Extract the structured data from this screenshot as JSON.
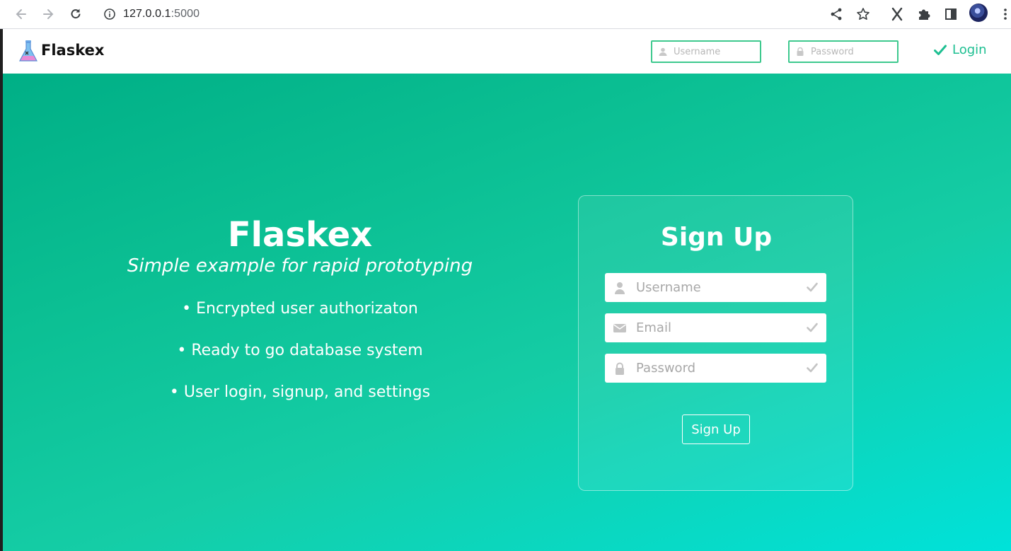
{
  "browser": {
    "url_host": "127.0.0.1",
    "url_port": ":5000"
  },
  "navbar": {
    "brand": "Flaskex",
    "username_placeholder": "Username",
    "password_placeholder": "Password",
    "login_label": "Login"
  },
  "hero": {
    "title": "Flaskex",
    "subtitle": "Simple example for rapid prototyping",
    "features": [
      "• Encrypted user authorizaton",
      "• Ready to go database system",
      "• User login, signup, and settings"
    ]
  },
  "signup": {
    "title": "Sign Up",
    "username_placeholder": "Username",
    "email_placeholder": "Email",
    "password_placeholder": "Password",
    "button_label": "Sign Up"
  },
  "colors": {
    "accent": "#1dbf91",
    "gradient_start": "#00af86",
    "gradient_end": "#00e2da"
  }
}
